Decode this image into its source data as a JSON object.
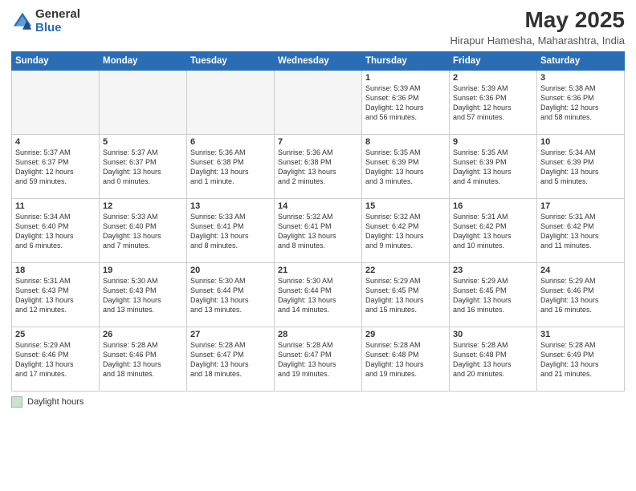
{
  "header": {
    "logo_general": "General",
    "logo_blue": "Blue",
    "main_title": "May 2025",
    "subtitle": "Hirapur Hamesha, Maharashtra, India"
  },
  "weekdays": [
    "Sunday",
    "Monday",
    "Tuesday",
    "Wednesday",
    "Thursday",
    "Friday",
    "Saturday"
  ],
  "weeks": [
    [
      {
        "day": "",
        "text": ""
      },
      {
        "day": "",
        "text": ""
      },
      {
        "day": "",
        "text": ""
      },
      {
        "day": "",
        "text": ""
      },
      {
        "day": "1",
        "text": "Sunrise: 5:39 AM\nSunset: 6:36 PM\nDaylight: 12 hours\nand 56 minutes."
      },
      {
        "day": "2",
        "text": "Sunrise: 5:39 AM\nSunset: 6:36 PM\nDaylight: 12 hours\nand 57 minutes."
      },
      {
        "day": "3",
        "text": "Sunrise: 5:38 AM\nSunset: 6:36 PM\nDaylight: 12 hours\nand 58 minutes."
      }
    ],
    [
      {
        "day": "4",
        "text": "Sunrise: 5:37 AM\nSunset: 6:37 PM\nDaylight: 12 hours\nand 59 minutes."
      },
      {
        "day": "5",
        "text": "Sunrise: 5:37 AM\nSunset: 6:37 PM\nDaylight: 13 hours\nand 0 minutes."
      },
      {
        "day": "6",
        "text": "Sunrise: 5:36 AM\nSunset: 6:38 PM\nDaylight: 13 hours\nand 1 minute."
      },
      {
        "day": "7",
        "text": "Sunrise: 5:36 AM\nSunset: 6:38 PM\nDaylight: 13 hours\nand 2 minutes."
      },
      {
        "day": "8",
        "text": "Sunrise: 5:35 AM\nSunset: 6:39 PM\nDaylight: 13 hours\nand 3 minutes."
      },
      {
        "day": "9",
        "text": "Sunrise: 5:35 AM\nSunset: 6:39 PM\nDaylight: 13 hours\nand 4 minutes."
      },
      {
        "day": "10",
        "text": "Sunrise: 5:34 AM\nSunset: 6:39 PM\nDaylight: 13 hours\nand 5 minutes."
      }
    ],
    [
      {
        "day": "11",
        "text": "Sunrise: 5:34 AM\nSunset: 6:40 PM\nDaylight: 13 hours\nand 6 minutes."
      },
      {
        "day": "12",
        "text": "Sunrise: 5:33 AM\nSunset: 6:40 PM\nDaylight: 13 hours\nand 7 minutes."
      },
      {
        "day": "13",
        "text": "Sunrise: 5:33 AM\nSunset: 6:41 PM\nDaylight: 13 hours\nand 8 minutes."
      },
      {
        "day": "14",
        "text": "Sunrise: 5:32 AM\nSunset: 6:41 PM\nDaylight: 13 hours\nand 8 minutes."
      },
      {
        "day": "15",
        "text": "Sunrise: 5:32 AM\nSunset: 6:42 PM\nDaylight: 13 hours\nand 9 minutes."
      },
      {
        "day": "16",
        "text": "Sunrise: 5:31 AM\nSunset: 6:42 PM\nDaylight: 13 hours\nand 10 minutes."
      },
      {
        "day": "17",
        "text": "Sunrise: 5:31 AM\nSunset: 6:42 PM\nDaylight: 13 hours\nand 11 minutes."
      }
    ],
    [
      {
        "day": "18",
        "text": "Sunrise: 5:31 AM\nSunset: 6:43 PM\nDaylight: 13 hours\nand 12 minutes."
      },
      {
        "day": "19",
        "text": "Sunrise: 5:30 AM\nSunset: 6:43 PM\nDaylight: 13 hours\nand 13 minutes."
      },
      {
        "day": "20",
        "text": "Sunrise: 5:30 AM\nSunset: 6:44 PM\nDaylight: 13 hours\nand 13 minutes."
      },
      {
        "day": "21",
        "text": "Sunrise: 5:30 AM\nSunset: 6:44 PM\nDaylight: 13 hours\nand 14 minutes."
      },
      {
        "day": "22",
        "text": "Sunrise: 5:29 AM\nSunset: 6:45 PM\nDaylight: 13 hours\nand 15 minutes."
      },
      {
        "day": "23",
        "text": "Sunrise: 5:29 AM\nSunset: 6:45 PM\nDaylight: 13 hours\nand 16 minutes."
      },
      {
        "day": "24",
        "text": "Sunrise: 5:29 AM\nSunset: 6:46 PM\nDaylight: 13 hours\nand 16 minutes."
      }
    ],
    [
      {
        "day": "25",
        "text": "Sunrise: 5:29 AM\nSunset: 6:46 PM\nDaylight: 13 hours\nand 17 minutes."
      },
      {
        "day": "26",
        "text": "Sunrise: 5:28 AM\nSunset: 6:46 PM\nDaylight: 13 hours\nand 18 minutes."
      },
      {
        "day": "27",
        "text": "Sunrise: 5:28 AM\nSunset: 6:47 PM\nDaylight: 13 hours\nand 18 minutes."
      },
      {
        "day": "28",
        "text": "Sunrise: 5:28 AM\nSunset: 6:47 PM\nDaylight: 13 hours\nand 19 minutes."
      },
      {
        "day": "29",
        "text": "Sunrise: 5:28 AM\nSunset: 6:48 PM\nDaylight: 13 hours\nand 19 minutes."
      },
      {
        "day": "30",
        "text": "Sunrise: 5:28 AM\nSunset: 6:48 PM\nDaylight: 13 hours\nand 20 minutes."
      },
      {
        "day": "31",
        "text": "Sunrise: 5:28 AM\nSunset: 6:49 PM\nDaylight: 13 hours\nand 21 minutes."
      }
    ]
  ],
  "legend": {
    "label": "Daylight hours"
  }
}
